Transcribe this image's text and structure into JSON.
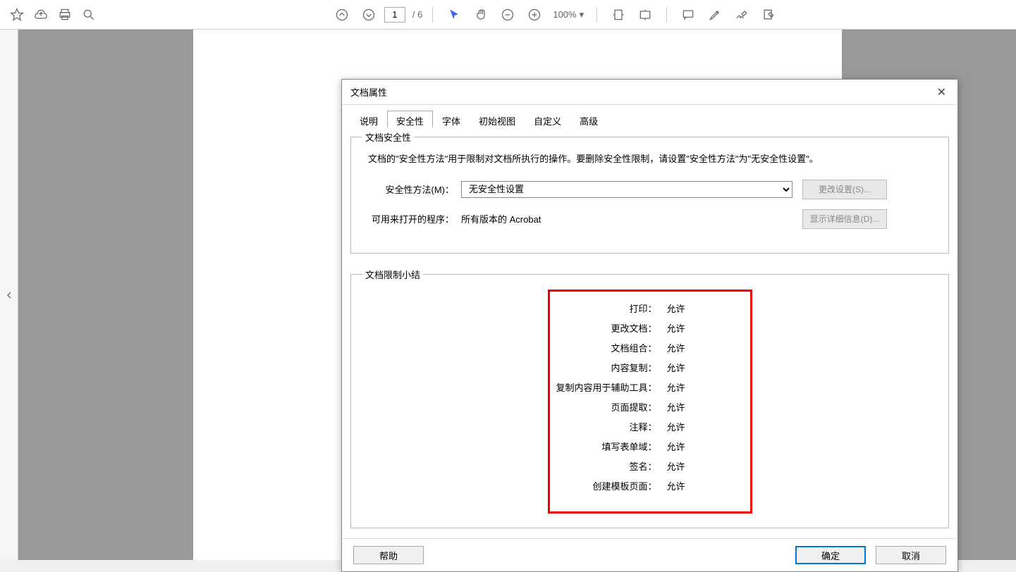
{
  "toolbar": {
    "current_page": "1",
    "total_pages": "/ 6",
    "zoom_level": "100%"
  },
  "dialog": {
    "title": "文档属性",
    "tabs": [
      "说明",
      "安全性",
      "字体",
      "初始视图",
      "自定义",
      "高级"
    ],
    "active_tab": 1,
    "security_section": {
      "legend": "文档安全性",
      "description": "文档的\"安全性方法\"用于限制对文档所执行的操作。要删除安全性限制，请设置\"安全性方法\"为\"无安全性设置\"。",
      "method_label": "安全性方法(M)：",
      "method_value": "无安全性设置",
      "change_btn": "更改设置(S)...",
      "open_with_label": "可用来打开的程序：",
      "open_with_value": "所有版本的 Acrobat",
      "details_btn": "显示详细信息(D)..."
    },
    "summary_section": {
      "legend": "文档限制小结",
      "rows": [
        {
          "label": "打印：",
          "value": "允许"
        },
        {
          "label": "更改文档：",
          "value": "允许"
        },
        {
          "label": "文档组合：",
          "value": "允许"
        },
        {
          "label": "内容复制：",
          "value": "允许"
        },
        {
          "label": "复制内容用于辅助工具：",
          "value": "允许"
        },
        {
          "label": "页面提取：",
          "value": "允许"
        },
        {
          "label": "注释：",
          "value": "允许"
        },
        {
          "label": "填写表单域：",
          "value": "允许"
        },
        {
          "label": "签名：",
          "value": "允许"
        },
        {
          "label": "创建模板页面：",
          "value": "允许"
        }
      ]
    },
    "footer": {
      "help": "帮助",
      "ok": "确定",
      "cancel": "取消"
    }
  }
}
